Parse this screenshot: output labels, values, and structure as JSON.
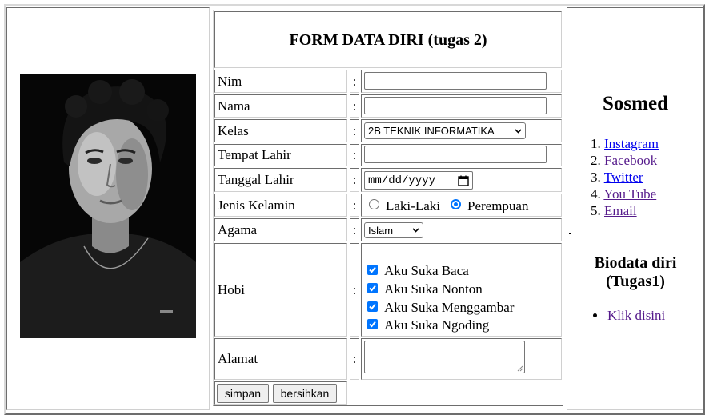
{
  "form": {
    "title": "FORM DATA DIRI (tugas 2)",
    "colon": ":",
    "fields": {
      "nim": "Nim",
      "nama": "Nama",
      "kelas": "Kelas",
      "tempat_lahir": "Tempat Lahir",
      "tanggal_lahir": "Tanggal Lahir",
      "jenis_kelamin": "Jenis Kelamin",
      "agama": "Agama",
      "hobi": "Hobi",
      "alamat": "Alamat"
    },
    "kelas_selected": "2B TEKNIK INFORMATIKA",
    "date_placeholder": "mm/dd/yyyy",
    "gender_options": {
      "male": "Laki-Laki",
      "female": "Perempuan",
      "selected": "Perempuan"
    },
    "agama_selected": "Islam",
    "hobi_options": [
      "Aku Suka Baca",
      "Aku Suka Nonton",
      "Aku Suka Menggambar",
      "Aku Suka Ngoding"
    ],
    "buttons": {
      "submit": "simpan",
      "reset": "bersihkan"
    }
  },
  "sosmed": {
    "title": "Sosmed",
    "links": [
      {
        "n": "1.",
        "label": "Instagram"
      },
      {
        "n": "2.",
        "label": "Facebook"
      },
      {
        "n": "3.",
        "label": "Twitter"
      },
      {
        "n": "4.",
        "label": "You Tube"
      },
      {
        "n": "5.",
        "label": "Email"
      }
    ]
  },
  "biodata": {
    "title_line1": "Biodata diri",
    "title_line2": "(Tugas1)",
    "link": "Klik disini"
  },
  "colors": {
    "link": "#0000ee",
    "visited": "#551a8b",
    "accent": "#0075ff"
  }
}
